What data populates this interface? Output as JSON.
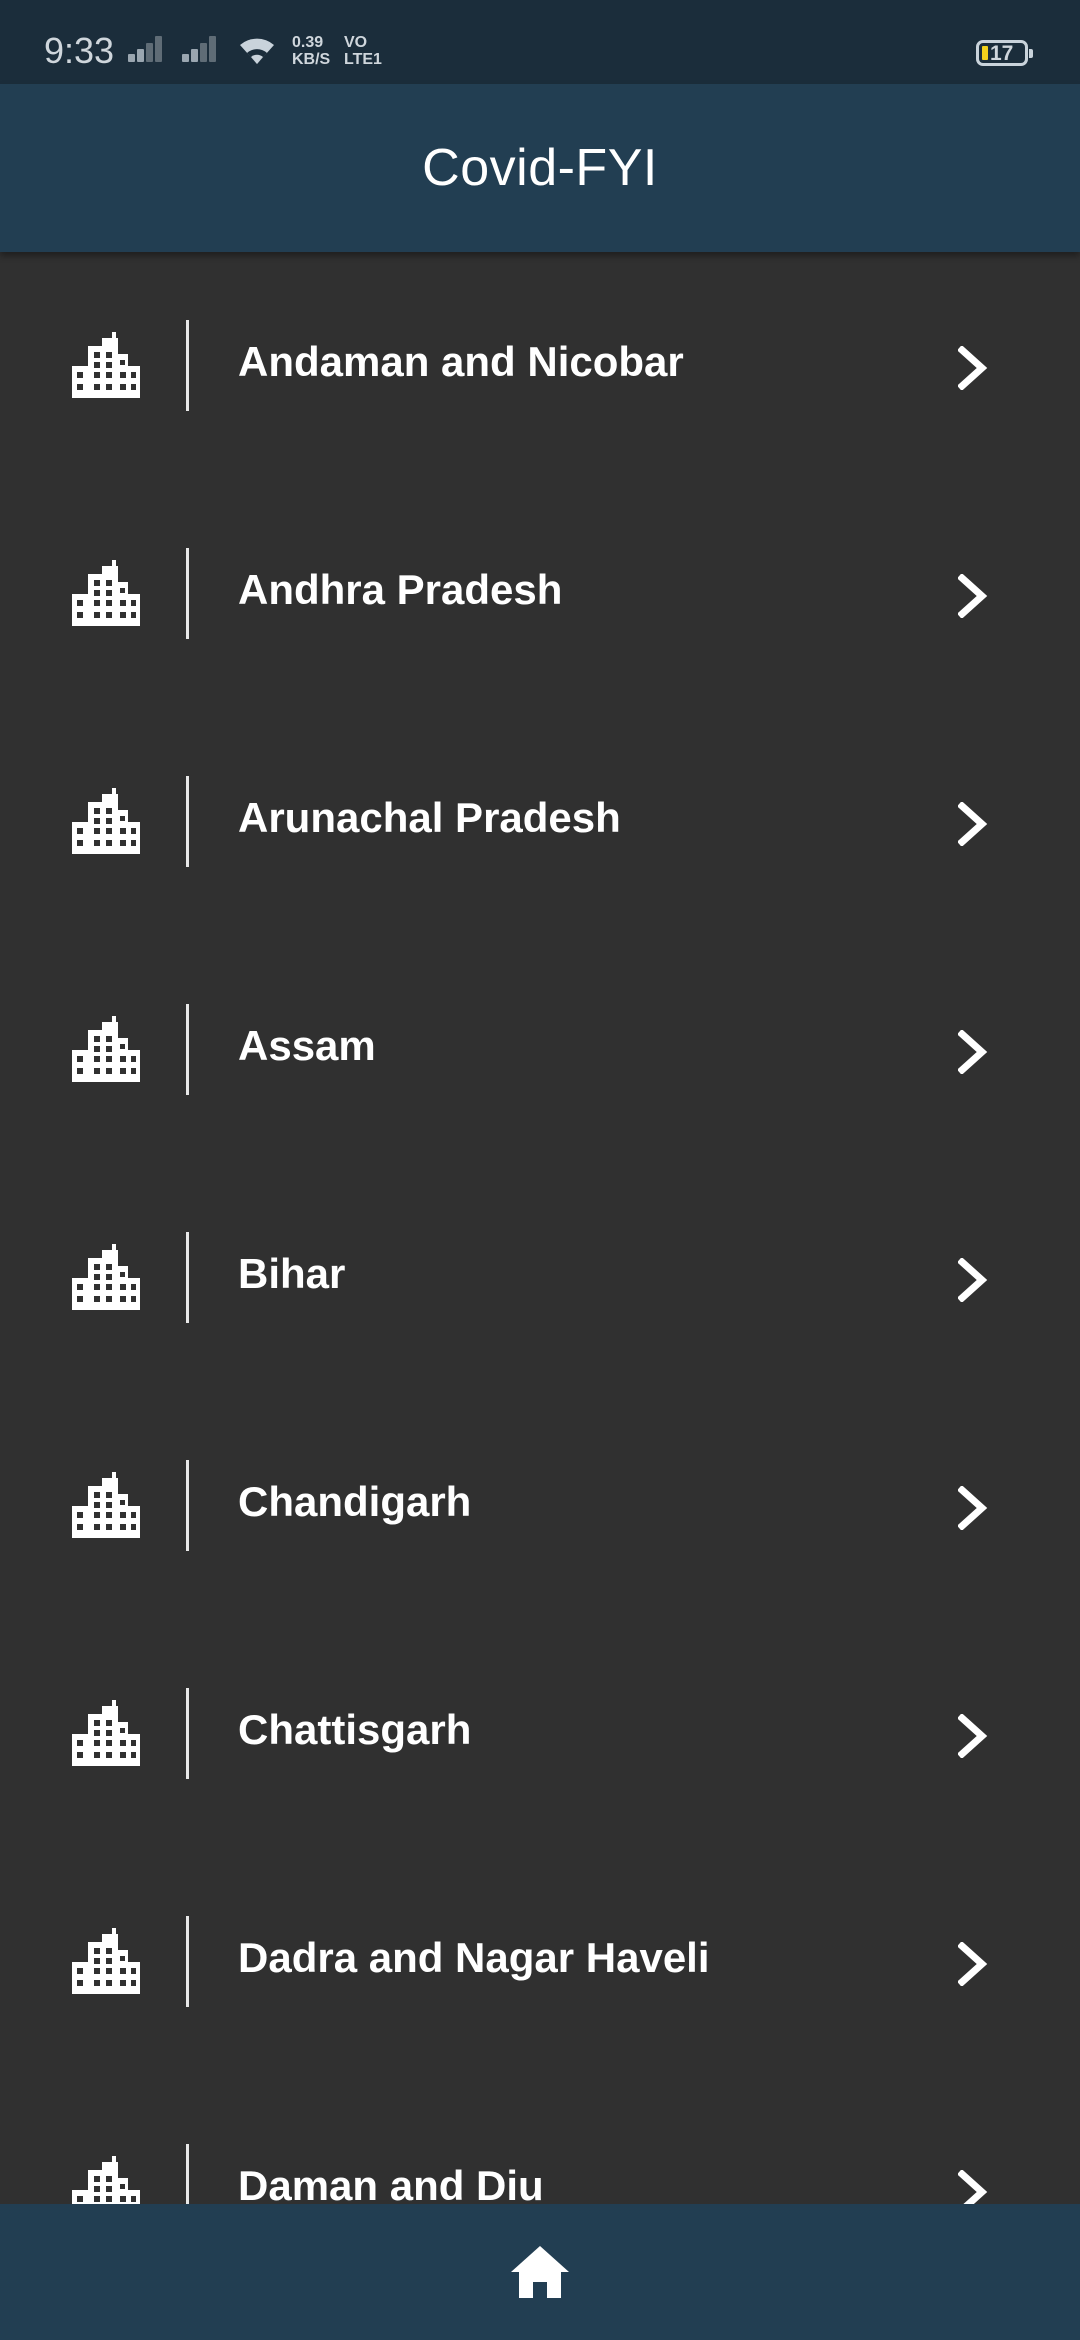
{
  "status_bar": {
    "time": "9:33",
    "net_speed_value": "0.39",
    "net_speed_unit": "KB/S",
    "volte_top": "VO",
    "volte_bottom": "LTE1",
    "battery_level": "17",
    "battery_color": "#f3d21c"
  },
  "app_bar": {
    "title": "Covid-FYI"
  },
  "states": [
    {
      "name": "Andaman and Nicobar"
    },
    {
      "name": "Andhra Pradesh"
    },
    {
      "name": "Arunachal Pradesh"
    },
    {
      "name": "Assam"
    },
    {
      "name": "Bihar"
    },
    {
      "name": "Chandigarh"
    },
    {
      "name": "Chattisgarh"
    },
    {
      "name": "Dadra and Nagar Haveli"
    },
    {
      "name": "Daman and Diu"
    }
  ],
  "icons": {
    "row_leading": "building-icon",
    "row_trailing": "chevron-right-icon",
    "bottom_nav": "home-icon"
  },
  "colors": {
    "background": "#303030",
    "app_bar": "#223e52",
    "status_bar": "#1b2d3b",
    "text": "#ffffff"
  }
}
